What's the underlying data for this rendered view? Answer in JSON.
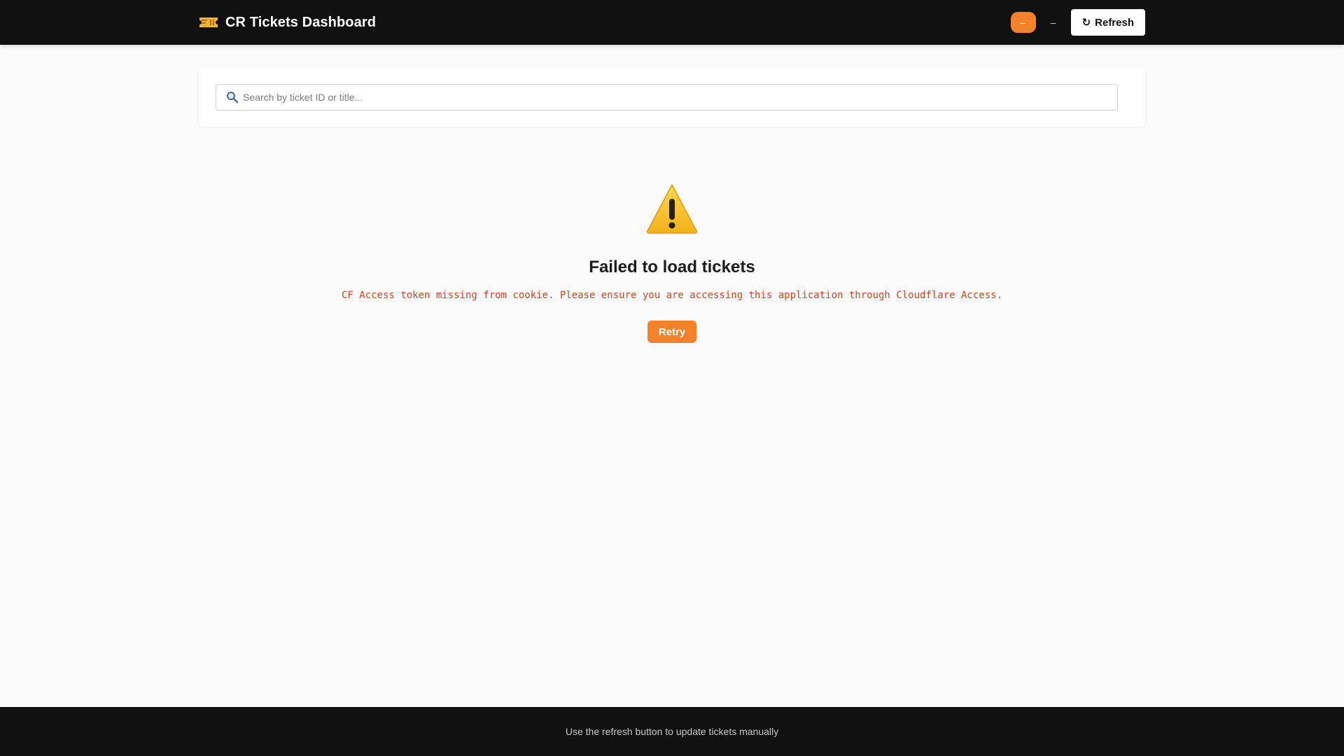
{
  "header": {
    "title": "CR Tickets Dashboard",
    "brand_icon": "ticket-icon",
    "toggle_label": "–",
    "dash_label": "–",
    "refresh_label": "Refresh",
    "refresh_icon": "↻",
    "accent_color": "#f4822b",
    "background_color": "#111111"
  },
  "search": {
    "icon": "search-icon",
    "placeholder": "Search by ticket ID or title...",
    "value": ""
  },
  "error": {
    "icon": "warning-icon",
    "title": "Failed to load tickets",
    "message": "CF Access token missing from cookie. Please ensure you are accessing this application through Cloudflare Access.",
    "retry_label": "Retry",
    "message_color": "#d9431e"
  },
  "footer": {
    "text": "Use the refresh button to update tickets manually"
  }
}
